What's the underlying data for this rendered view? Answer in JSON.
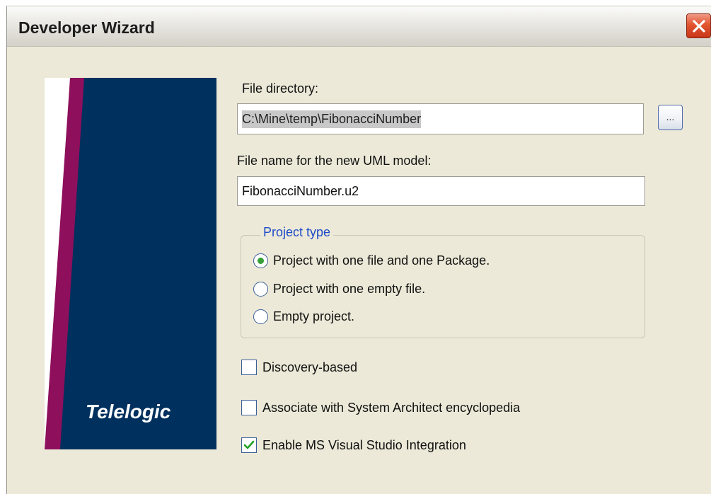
{
  "window": {
    "title": "Developer Wizard"
  },
  "banner": {
    "logo_text": "Telelogic",
    "colors": {
      "navy": "#00305e",
      "magenta": "#8e0f5c"
    }
  },
  "file_directory": {
    "label": "File directory:",
    "value": "C:\\Mine\\temp\\FibonacciNumber",
    "browse_label": "..."
  },
  "file_name": {
    "label": "File name for the new UML model:",
    "value": "FibonacciNumber.u2"
  },
  "project_type": {
    "title": "Project type",
    "options": [
      {
        "label": "Project with one file and one Package.",
        "selected": true
      },
      {
        "label": "Project with one empty file.",
        "selected": false
      },
      {
        "label": "Empty project.",
        "selected": false
      }
    ]
  },
  "options": [
    {
      "label": "Discovery-based",
      "checked": false
    },
    {
      "label": "Associate with System Architect encyclopedia",
      "checked": false
    },
    {
      "label": "Enable MS Visual Studio Integration",
      "checked": true
    }
  ],
  "icons": {
    "close": "close-icon",
    "checkmark": "checkmark-icon"
  }
}
